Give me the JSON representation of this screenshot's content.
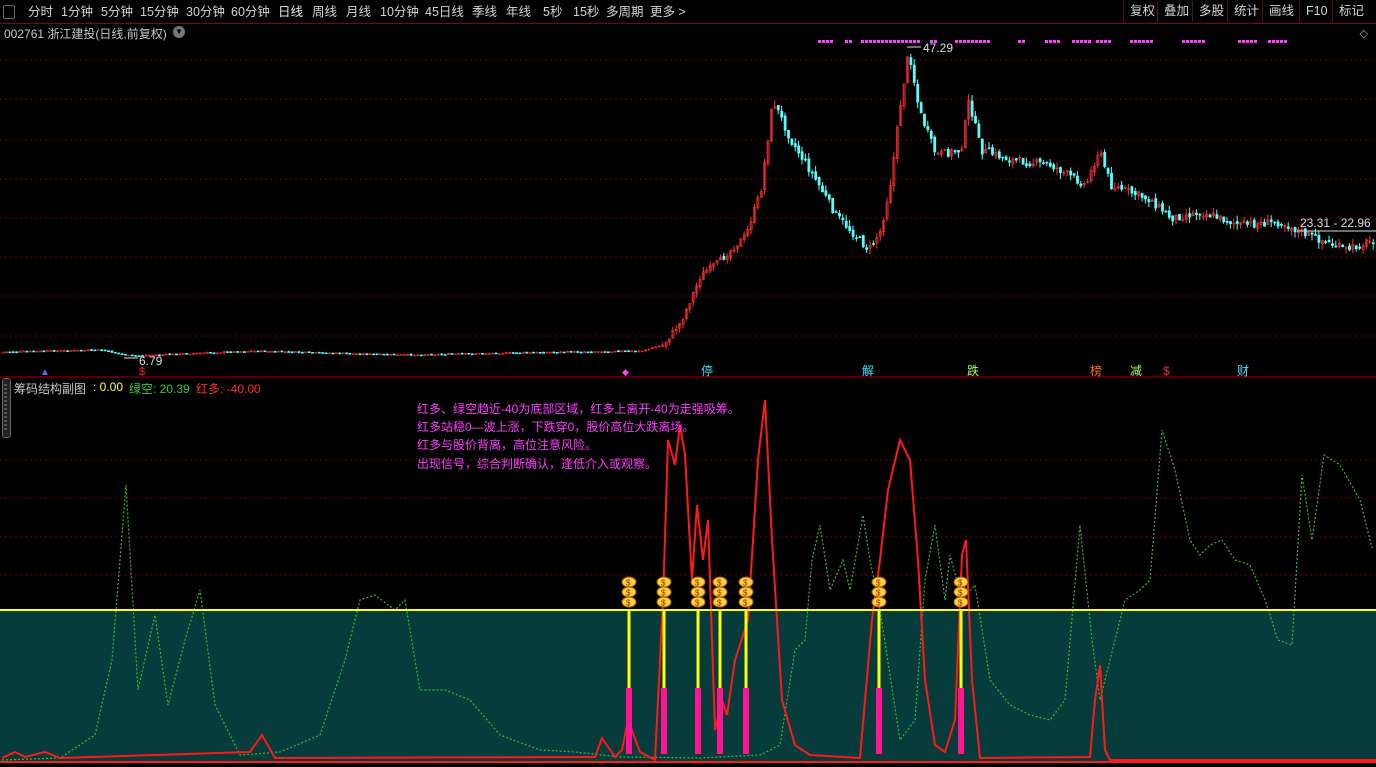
{
  "toolbar": {
    "periods": [
      "分时",
      "1分钟",
      "5分钟",
      "15分钟",
      "30分钟",
      "60分钟",
      "日线",
      "周线",
      "月线",
      "10分钟",
      "45日线",
      "季线",
      "年线",
      "5秒",
      "15秒",
      "多周期",
      "更多 >"
    ],
    "active": "日线",
    "right_buttons": [
      "复权",
      "叠加",
      "多股",
      "统计",
      "画线",
      "F10",
      "标记"
    ]
  },
  "stock": {
    "title": "002761 浙江建投(日线,前复权)",
    "high_label": "47.29",
    "low_label": "6.79",
    "price_range_label": "23.31 - 22.96"
  },
  "event_markers": [
    {
      "text": "停",
      "color": "#40e0ff"
    },
    {
      "text": "解",
      "color": "#40e0ff"
    },
    {
      "text": "跌",
      "color": "#a0ff60"
    },
    {
      "text": "榜",
      "color": "#ff6a30"
    },
    {
      "text": "减",
      "color": "#a0ff60"
    },
    {
      "text": "$",
      "color": "#ff2040"
    },
    {
      "text": "财",
      "color": "#40e0ff"
    }
  ],
  "indicator": {
    "name": "筹码结构副图",
    "value0": ": 0.00",
    "green_label": "绿空: 20.39",
    "red_label": "红多: -40.00",
    "annotations": [
      "红多、绿空趋近-40为底部区域，红多上离开-40为走强吸筹。",
      "红多站稳0—波上涨，下跌穿0，股价高位大跌离场。",
      "红多与股价背离，高位注意风险。",
      "出现信号，综合判断确认，逢低介入或观察。"
    ]
  },
  "colors": {
    "up": "#ff3030",
    "down": "#54ffff",
    "green_line": "#3dbb2a",
    "red_line": "#ff1a1a",
    "zero_line": "#ffff00",
    "fill": "#063c3c",
    "grid": "#7a0000",
    "annotation": "#ff3cff"
  }
}
